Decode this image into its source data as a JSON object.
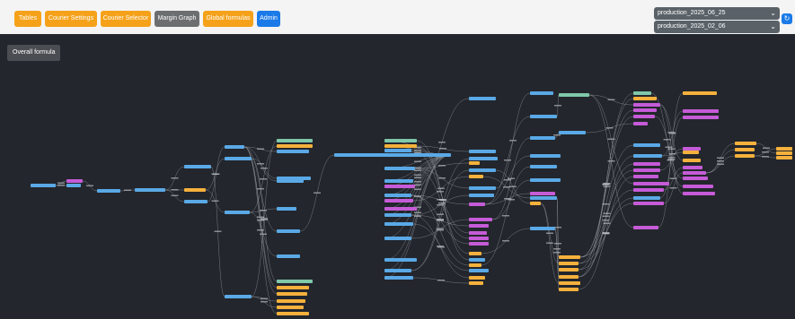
{
  "toolbar": {
    "buttons": [
      {
        "label": "Tables",
        "color": "#f5a21a"
      },
      {
        "label": "Courier Settings",
        "color": "#f5a21a"
      },
      {
        "label": "Courier Selector",
        "color": "#f5a21a"
      },
      {
        "label": "Margin Graph",
        "color": "#6c6e70"
      },
      {
        "label": "Global formulas",
        "color": "#f5a21a"
      },
      {
        "label": "Admin",
        "color": "#1a7be8"
      }
    ]
  },
  "selects": {
    "primary_value": "production_2025_06_25",
    "secondary_value": "production_2025_02_06"
  },
  "graph": {
    "label_button": "Overall formula",
    "background": "#23262c",
    "node_colors": {
      "blue": "#5aa9e6",
      "orange": "#f5b13c",
      "purple": "#c65bd8",
      "green": "#7fc8a9"
    }
  }
}
